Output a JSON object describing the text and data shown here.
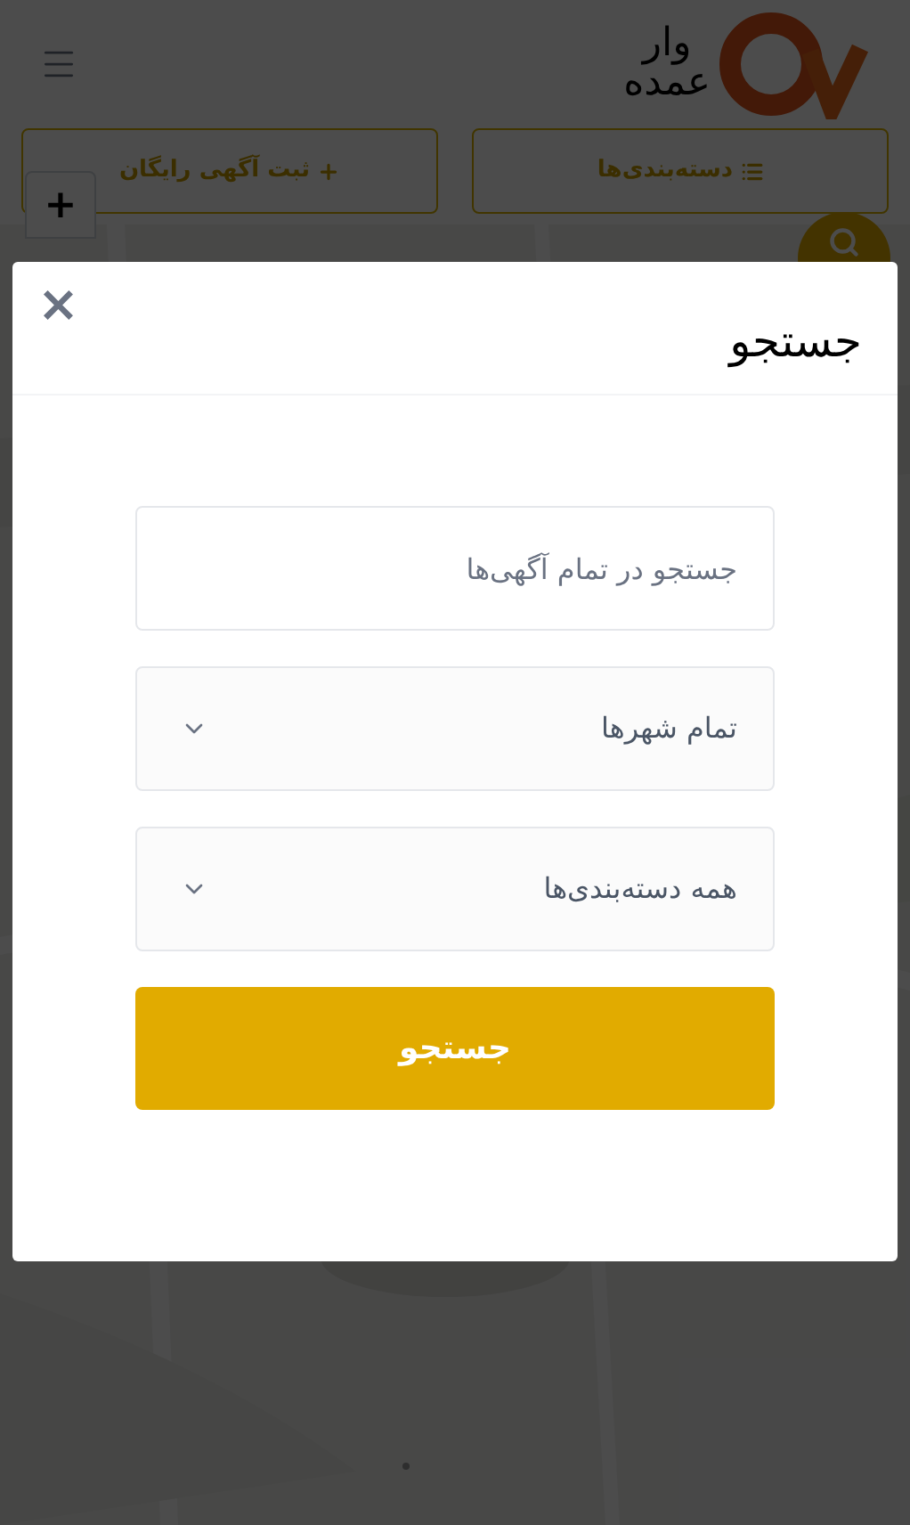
{
  "header": {
    "logo_lines": [
      "وار",
      "عمده"
    ]
  },
  "actions": [
    {
      "label": "دسته‌بندی‌ها",
      "kind": "categories"
    },
    {
      "label": "ثبت آگهی رایگان",
      "kind": "post"
    }
  ],
  "map": {
    "kind": "picture",
    "zoom_in": "+"
  },
  "modal": {
    "title": "جستجو",
    "close": "×",
    "search": {
      "placeholder": "جستجو در تمام آگهی‌ها"
    },
    "selects": [
      {
        "value": "تمام شهرها"
      },
      {
        "value": "همه دسته‌بندی‌ها"
      }
    ],
    "submit": "جستجو"
  }
}
